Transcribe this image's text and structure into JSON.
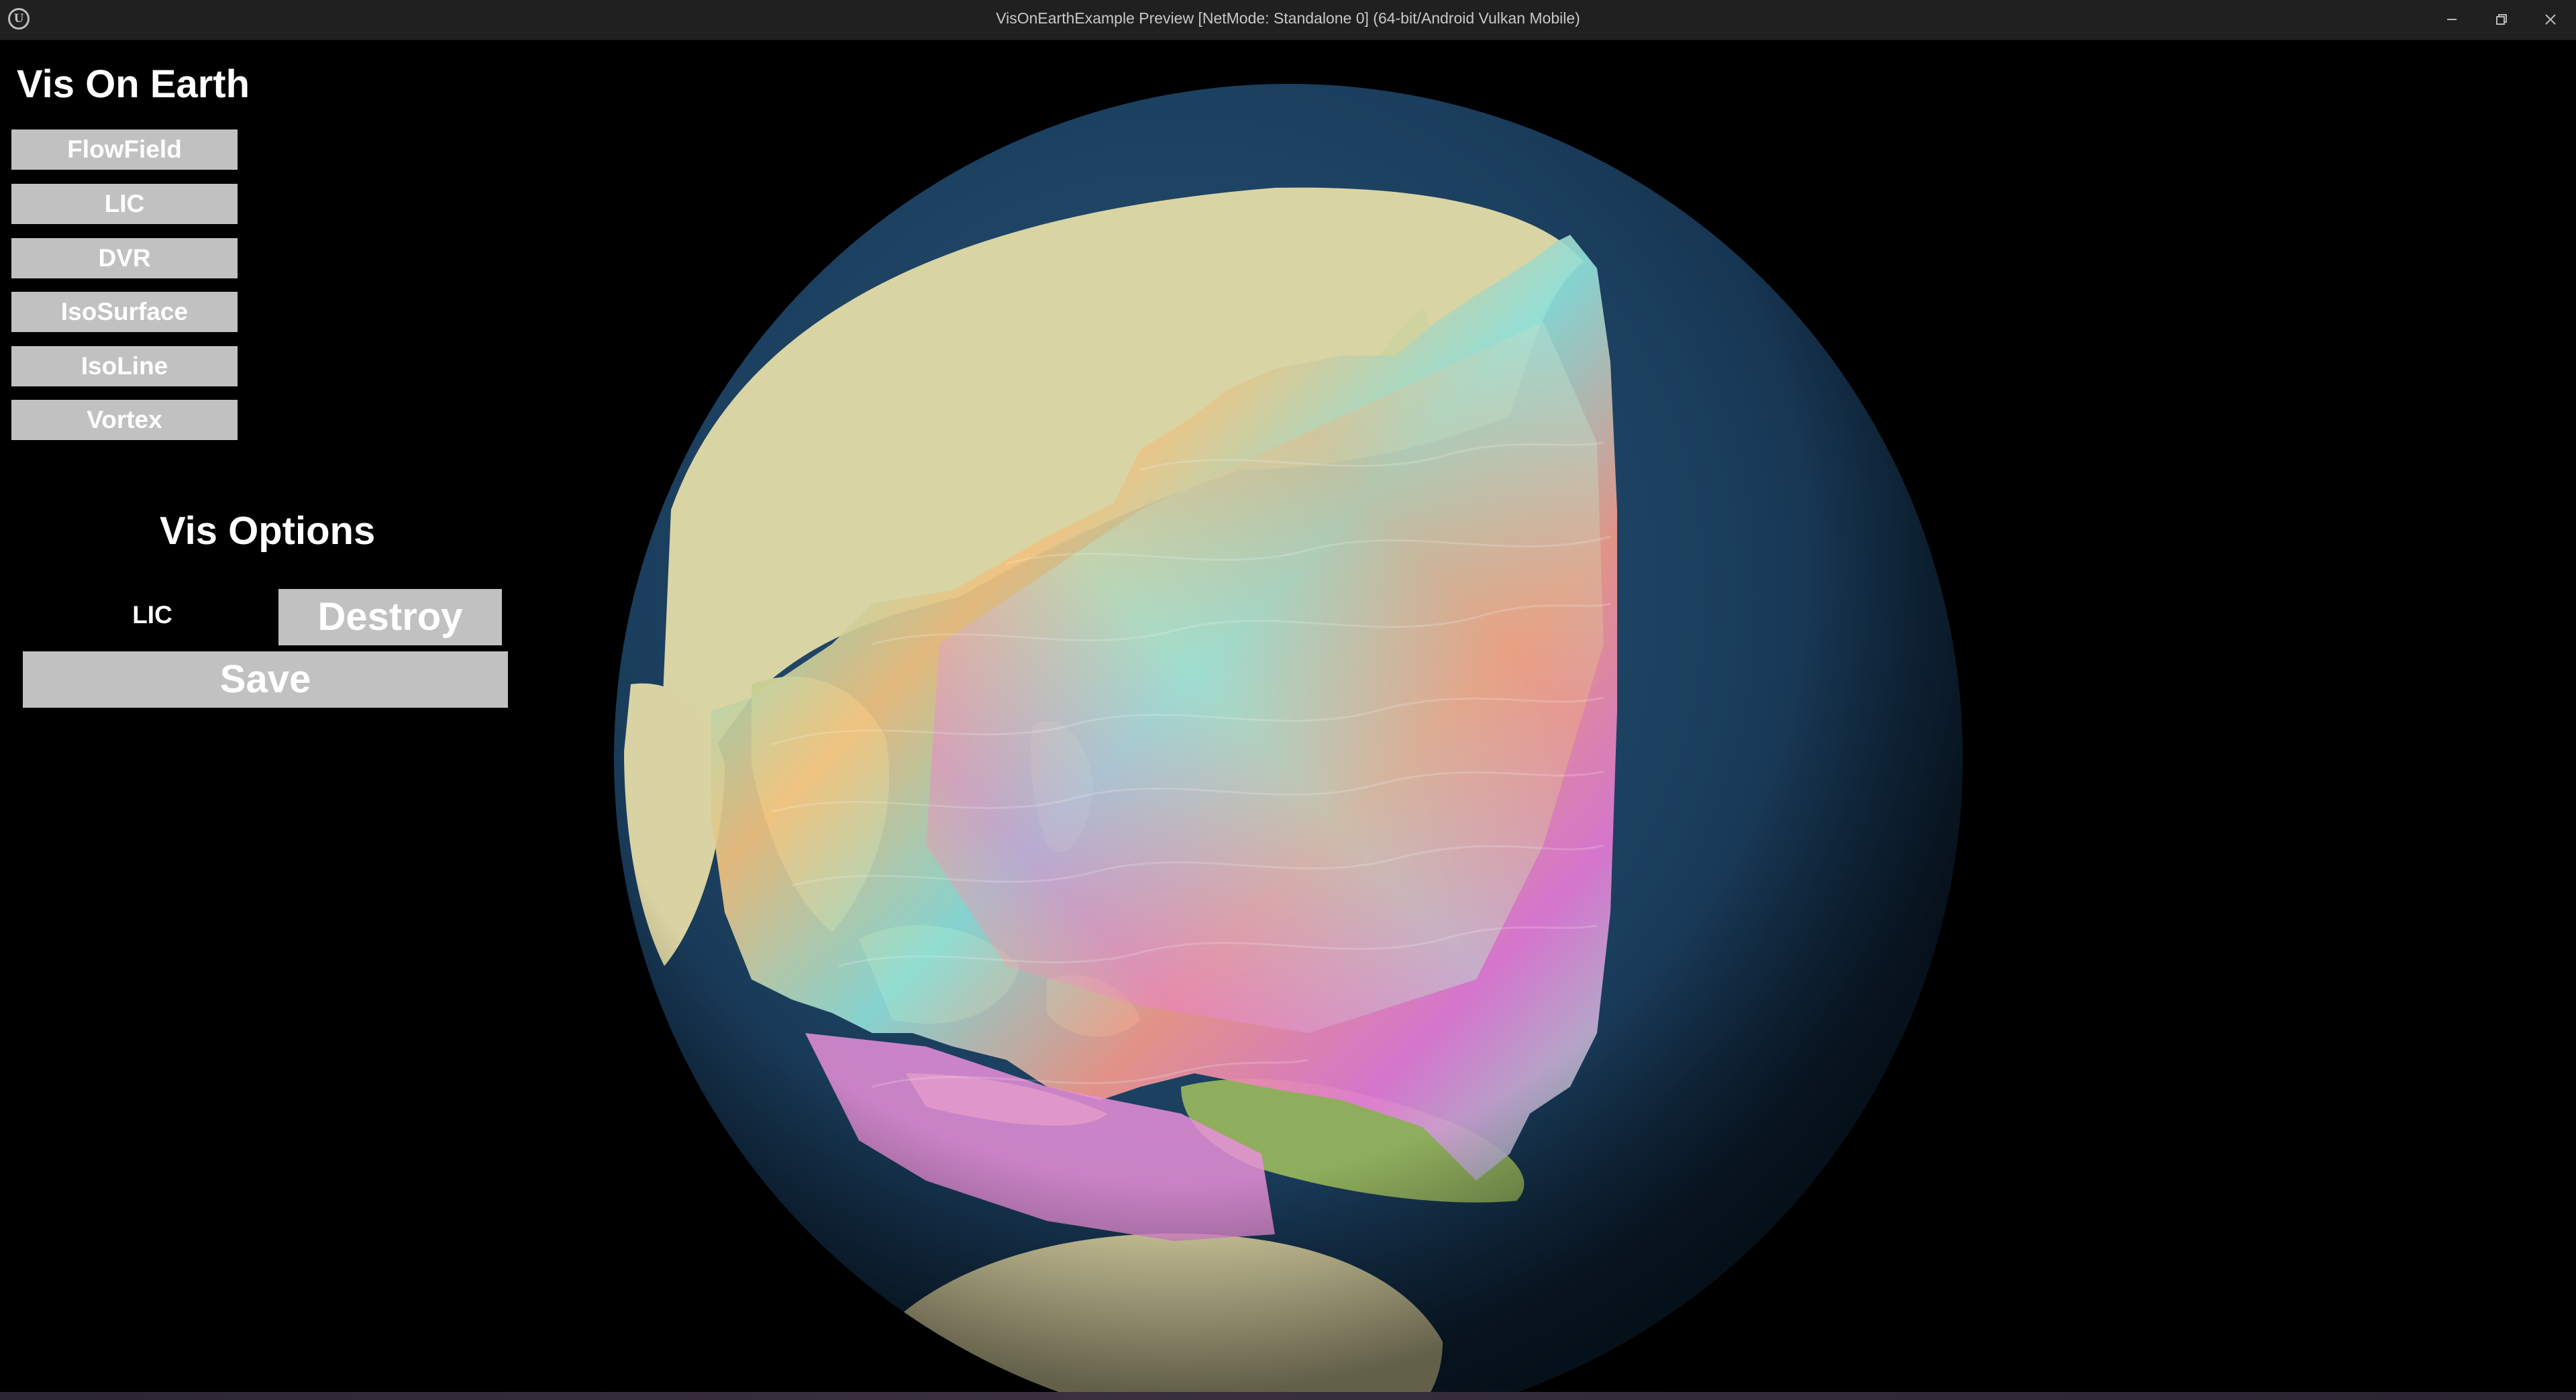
{
  "window": {
    "title": "VisOnEarthExample Preview [NetMode: Standalone 0]  (64-bit/Android Vulkan Mobile)",
    "logo_icon": "unreal-engine-logo-icon",
    "controls": [
      "minimize-icon",
      "restore-icon",
      "close-icon"
    ]
  },
  "menu": {
    "title": "Vis On Earth",
    "buttons": [
      {
        "label": "FlowField"
      },
      {
        "label": "LIC"
      },
      {
        "label": "DVR"
      },
      {
        "label": "IsoSurface"
      },
      {
        "label": "IsoLine"
      },
      {
        "label": "Vortex"
      }
    ]
  },
  "options": {
    "title": "Vis Options",
    "current_label": "LIC",
    "destroy_label": "Destroy",
    "save_label": "Save"
  },
  "colors": {
    "button_bg": "#c1c1c1",
    "button_text": "#ffffff",
    "titlebar_bg": "#202020",
    "viewport_bg": "#000000",
    "ocean": "#17344f",
    "land": "#d6d3a3"
  }
}
